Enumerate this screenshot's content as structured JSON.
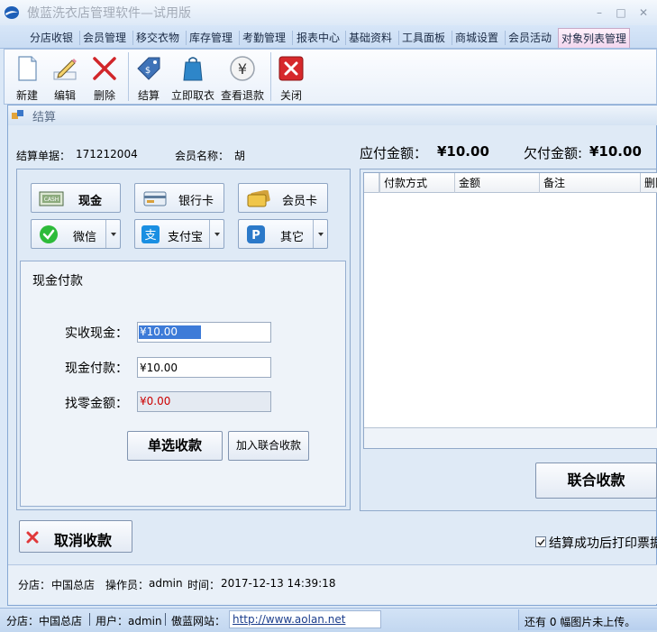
{
  "window": {
    "title": "傲蓝洗衣店管理软件—试用版",
    "controls": [
      "minimize-icon",
      "restore-icon",
      "close-icon"
    ]
  },
  "menu": {
    "tabs": [
      {
        "label": "分店收银"
      },
      {
        "label": "会员管理"
      },
      {
        "label": "移交衣物"
      },
      {
        "label": "库存管理"
      },
      {
        "label": "考勤管理"
      },
      {
        "label": "报表中心"
      },
      {
        "label": "基础资料"
      },
      {
        "label": "工具面板"
      },
      {
        "label": "商城设置"
      },
      {
        "label": "会员活动"
      },
      {
        "label": "对象列表管理",
        "active": true
      }
    ]
  },
  "toolbar": {
    "new_label": "新建",
    "edit_label": "编辑",
    "delete_label": "删除",
    "checkout_label": "结算",
    "pickup_label": "立即取衣",
    "refund_label": "查看退款",
    "close_label": "关闭"
  },
  "dialog": {
    "title": "结算",
    "order_label": "结算单据：",
    "order_value": "171212004",
    "member_label": "会员名称：",
    "member_value": "胡",
    "payable_label": "应付金额：",
    "payable_value": "¥10.00",
    "owed_label": "欠付金额:",
    "owed_value": "¥10.00"
  },
  "payment_methods": {
    "cash": "现金",
    "bank_card": "银行卡",
    "member_card": "会员卡",
    "wechat": "微信",
    "alipay": "支付宝",
    "other": "其它"
  },
  "cash_payment": {
    "heading": "现金付款",
    "received_label": "实收现金：",
    "received_value": "¥10.00",
    "paid_label": "现金付款：",
    "paid_value": "¥10.00",
    "change_label": "找零金额：",
    "change_value": "¥0.00",
    "single_pay_button": "单选收款",
    "add_combined_button": "加入联合收款"
  },
  "grid": {
    "columns": [
      "付款方式",
      "金额",
      "备注",
      "删除"
    ]
  },
  "combined_pay_button": "联合收款",
  "cancel_button": "取消收款",
  "print_checkbox_label": "结算成功后打印票据",
  "print_checked": true,
  "info": {
    "branch_label": "分店：",
    "branch_value": "中国总店",
    "operator_label": "操作员：",
    "operator_value": "admin",
    "time_label": "时间：",
    "time_value": "2017-12-13 14:39:18"
  },
  "statusbar": {
    "branch": "分店：中国总店",
    "user": "用户：admin",
    "site_label": "傲蓝网站：",
    "url": "http://www.aolan.net",
    "upload_status": "还有 0 幅图片未上传。"
  },
  "colors": {
    "accent": "#1f5fb5",
    "danger": "#d3201f",
    "change_text": "#cc0000",
    "active_tab": "#f2d6ee"
  }
}
